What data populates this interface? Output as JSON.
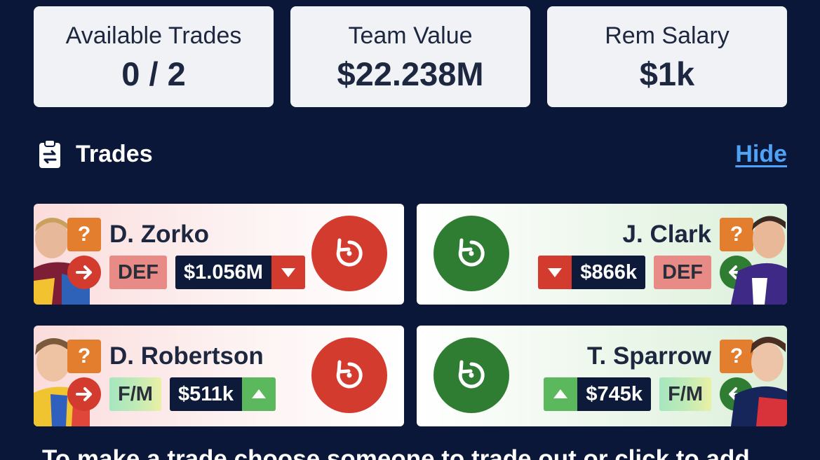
{
  "stats": [
    {
      "label": "Available Trades",
      "value": "0 / 2"
    },
    {
      "label": "Team Value",
      "value": "$22.238M"
    },
    {
      "label": "Rem Salary",
      "value": "$1k"
    }
  ],
  "section": {
    "title": "Trades",
    "hide_label": "Hide",
    "icon": "clipboard-swap-icon"
  },
  "trades": [
    {
      "out": {
        "name": "D. Zorko",
        "badge": "?",
        "position": "DEF",
        "price": "$1.056M",
        "trend": "down"
      },
      "in": {
        "name": "J. Clark",
        "badge": "?",
        "position": "DEF",
        "price": "$866k",
        "trend": "down"
      }
    },
    {
      "out": {
        "name": "D. Robertson",
        "badge": "?",
        "position": "F/M",
        "price": "$511k",
        "trend": "up"
      },
      "in": {
        "name": "T. Sparrow",
        "badge": "?",
        "position": "F/M",
        "price": "$745k",
        "trend": "up"
      }
    }
  ],
  "footer": {
    "text": "To make a trade choose someone to trade out or click to add"
  },
  "colors": {
    "background": "#0b1738",
    "out_red": "#d33b2e",
    "in_green": "#2f7c33",
    "badge_orange": "#e37e2f",
    "link_blue": "#4fa3f7"
  }
}
